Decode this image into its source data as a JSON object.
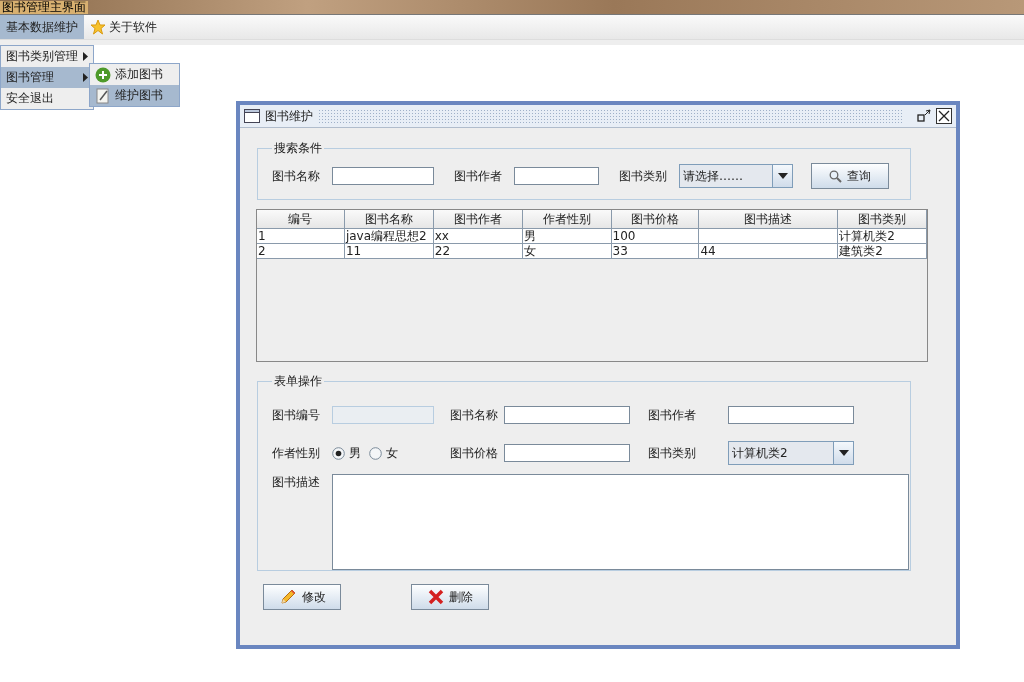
{
  "app_title": "图书管理主界面",
  "menubar": [
    {
      "label": "基本数据维护",
      "selected": true,
      "kind": "plain"
    },
    {
      "label": "关于软件",
      "selected": false,
      "kind": "starred"
    }
  ],
  "menu": [
    {
      "label": "图书类别管理",
      "kind": "submenu",
      "selected": false
    },
    {
      "label": "图书管理",
      "kind": "submenu",
      "selected": true
    },
    {
      "label": "安全退出",
      "kind": "item",
      "selected": false
    }
  ],
  "submenu": [
    {
      "label": "添加图书",
      "kind": "add",
      "selected": false
    },
    {
      "label": "维护图书",
      "kind": "edit",
      "selected": true
    }
  ],
  "window": {
    "title": "图书维护",
    "search": {
      "legend": "搜索条件",
      "name_label": "图书名称",
      "author_label": "图书作者",
      "type_label": "图书类别",
      "type_value": "请选择……",
      "button": "查询"
    },
    "table": {
      "columns": [
        "编号",
        "图书名称",
        "图书作者",
        "作者性别",
        "图书价格",
        "图书描述",
        "图书类别"
      ],
      "rows": [
        [
          "1",
          "java编程思想2",
          "xx",
          "男",
          "100",
          "",
          "计算机类2"
        ],
        [
          "2",
          "11",
          "22",
          "女",
          "33",
          "44",
          "建筑类2"
        ]
      ]
    },
    "form": {
      "legend": "表单操作",
      "id_label": "图书编号",
      "name_label": "图书名称",
      "author_label": "图书作者",
      "sex_label": "作者性别",
      "sex_options": [
        {
          "label": "男",
          "selected": true
        },
        {
          "label": "女",
          "selected": false
        }
      ],
      "price_label": "图书价格",
      "type_label": "图书类别",
      "type_value": "计算机类2",
      "desc_label": "图书描述"
    },
    "buttons": [
      {
        "label": "修改",
        "kind": "edit"
      },
      {
        "label": "删除",
        "kind": "delete"
      }
    ]
  }
}
